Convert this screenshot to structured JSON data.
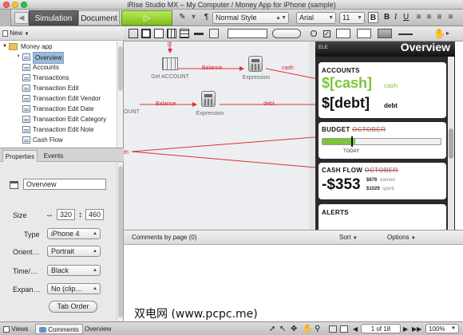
{
  "window": {
    "title": "iRise Studio MX – My Computer / Money App for iPhone (sample)"
  },
  "toolbar": {
    "modes": [
      "Simulation",
      "Document"
    ],
    "style_value": "Normal Style",
    "font_value": "Arial",
    "size_value": "11",
    "bold": "B",
    "italic": "I",
    "underline": "U"
  },
  "page_panel": {
    "new_label": "New",
    "tree": [
      {
        "label": "Money app",
        "type": "folder"
      },
      {
        "label": "Overview",
        "type": "page",
        "selected": true
      },
      {
        "label": "Accounts",
        "type": "page"
      },
      {
        "label": "Transactions",
        "type": "page"
      },
      {
        "label": "Transaction Edit",
        "type": "page"
      },
      {
        "label": "Transaction Edit Vendor",
        "type": "page"
      },
      {
        "label": "Transaction Edit Date",
        "type": "page"
      },
      {
        "label": "Transaction Edit Category",
        "type": "page"
      },
      {
        "label": "Transaction Edit Note",
        "type": "page"
      },
      {
        "label": "Cash Flow",
        "type": "page"
      }
    ]
  },
  "properties": {
    "tabs": [
      "Properties",
      "Events"
    ],
    "name_value": "Overview",
    "size_label": "Size",
    "width_value": "320",
    "height_value": "460",
    "type_label": "Type",
    "type_value": "iPhone 4",
    "orient_label": "Orient…",
    "orient_value": "Portrait",
    "time_label": "Time/…",
    "time_value": "Black",
    "expan_label": "Expan…",
    "expan_value": "No (clip…",
    "tab_order_label": "Tab Order"
  },
  "flow": {
    "nodes": [
      "Get ACCOUNT",
      "Expression",
      "OUNT",
      "Expression"
    ],
    "edges": [
      "Balance",
      "cash",
      "Balance",
      "debt",
      "th"
    ],
    "top_marker": "[c"
  },
  "phone": {
    "header": "Overview",
    "top_label": "ELE",
    "accounts_title": "ACCOUNTS",
    "cash_value": "$[cash]",
    "cash_label": "cash",
    "debt_value": "$[debt]",
    "debt_label": "debt",
    "budget_title": "BUDGET",
    "budget_month": "OCTOBER",
    "today_label": "TODAY",
    "cashflow_title": "CASH FLOW",
    "cashflow_month": "OCTOBER",
    "cashflow_value": "-$353",
    "earned_amount": "$676",
    "earned_label": "earned",
    "spent_amount": "$1029",
    "spent_label": "spent",
    "alerts_title": "ALERTS",
    "budget_progress": 0.28
  },
  "comments": {
    "header": "Comments by page (0)",
    "sort_label": "Sort",
    "options_label": "Options"
  },
  "statusbar": {
    "tabs": [
      "Views",
      "Comments"
    ],
    "active_page": "Overview",
    "page_counter": "1 of 18",
    "zoom": "100%"
  },
  "watermark": "双电网 (www.pcpc.me)",
  "colors": {
    "accent_green": "#6cbf2a",
    "arrow_red": "#e03030",
    "selection": "#9eb9d8"
  }
}
